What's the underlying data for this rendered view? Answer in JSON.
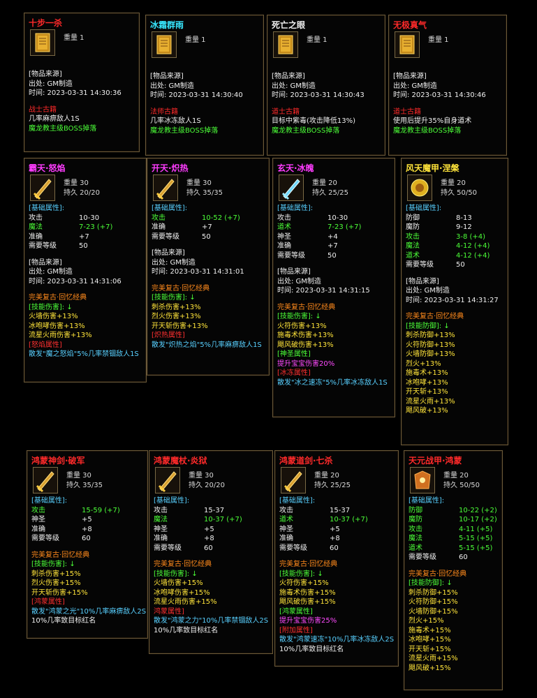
{
  "row1": [
    {
      "title": "十步一杀",
      "title_color": "#ff2a2a",
      "weight": "重量 1",
      "source": [
        "[物品来源]",
        "出处: GM制造",
        "时间: 2023-03-31 14:30:36"
      ],
      "lines": [
        [
          "战士古籍",
          "#ff2a2a"
        ],
        [
          "几率麻痹敌人1S",
          "#f0f0f0"
        ],
        [
          "魔龙教主级BOSS掉落",
          "#4cff38"
        ]
      ]
    },
    {
      "title": "冰霜群雨",
      "title_color": "#38e8ff",
      "weight": "重量 1",
      "source": [
        "[物品来源]",
        "出处: GM制造",
        "时间: 2023-03-31 14:30:40"
      ],
      "lines": [
        [
          "法师古籍",
          "#ff2a2a"
        ],
        [
          "几率冰冻敌人1S",
          "#f0f0f0"
        ],
        [
          "魔龙教主级BOSS掉落",
          "#4cff38"
        ]
      ]
    },
    {
      "title": "死亡之眼",
      "title_color": "#f0f0f0",
      "weight": "重量 1",
      "source": [
        "[物品来源]",
        "出处: GM制造",
        "时间: 2023-03-31 14:30:43"
      ],
      "lines": [
        [
          "道士古籍",
          "#ff2a2a"
        ],
        [
          "目标中紫毒(攻击降低13%)",
          "#f0f0f0"
        ],
        [
          "魔龙教主级BOSS掉落",
          "#4cff38"
        ]
      ]
    },
    {
      "title": "无极真气",
      "title_color": "#ff2a2a",
      "weight": "重量 1",
      "source": [
        "[物品来源]",
        "出处: GM制造",
        "时间: 2023-03-31 14:30:46"
      ],
      "lines": [
        [
          "道士古籍",
          "#ff2a2a"
        ],
        [
          "使用后提升35%自身道术",
          "#f0f0f0"
        ],
        [
          "魔龙教主级BOSS掉落",
          "#4cff38"
        ]
      ]
    }
  ],
  "row2": [
    {
      "title": "霸天·怒焰",
      "title_color": "#ff3cff",
      "weight": "重量 30",
      "dura": "持久 20/20",
      "basic_header": "[基础属性]:",
      "stats": [
        [
          "攻击",
          "10-30",
          "#f0f0f0"
        ],
        [
          "魔法",
          "7-23 (+7)",
          "#4cff38"
        ],
        [
          "准确",
          "+7",
          "#f0f0f0"
        ],
        [
          "需要等级",
          "50",
          "#f0f0f0"
        ]
      ],
      "source": [
        "[物品来源]",
        "出处: GM制造",
        "时间: 2023-03-31 14:31:06"
      ],
      "lines": [
        [
          "完美复古·回忆经典",
          "#ff8a1c"
        ],
        [
          "[技能伤害]: ↓",
          "#4cff38"
        ],
        [
          "火墙伤害+13%",
          "#ffe43a"
        ],
        [
          "冰咆哮伤害+13%",
          "#ffe43a"
        ],
        [
          "流星火雨伤害+13%",
          "#ffe43a"
        ],
        [
          "[怒焰属性]",
          "#ff3030"
        ],
        [
          "散发\"魔之怒焰\"5%几率禁锢敌人1S",
          "#58d0ff"
        ]
      ]
    },
    {
      "title": "开天·炽热",
      "title_color": "#ff3cff",
      "weight": "重量 30",
      "dura": "持久 35/35",
      "basic_header": "[基础属性]:",
      "stats": [
        [
          "攻击",
          "10-52 (+7)",
          "#4cff38"
        ],
        [
          "准确",
          "+7",
          "#f0f0f0"
        ],
        [
          "需要等级",
          "50",
          "#f0f0f0"
        ]
      ],
      "source": [
        "[物品来源]",
        "出处: GM制造",
        "时间: 2023-03-31 14:31:01"
      ],
      "lines": [
        [
          "完美复古·回忆经典",
          "#ff8a1c"
        ],
        [
          "[技能伤害]: ↓",
          "#4cff38"
        ],
        [
          "刺杀伤害+13%",
          "#ffe43a"
        ],
        [
          "烈火伤害+13%",
          "#ffe43a"
        ],
        [
          "开天斩伤害+13%",
          "#ffe43a"
        ],
        [
          "[炽热属性]",
          "#ff3030"
        ],
        [
          "散发\"炽热之焰\"5%几率麻痹敌人1S",
          "#58d0ff"
        ]
      ]
    },
    {
      "title": "玄天·冰魄",
      "title_color": "#ff3cff",
      "weight": "重量 20",
      "dura": "持久 25/25",
      "basic_header": "[基础属性]:",
      "stats": [
        [
          "攻击",
          "10-30",
          "#f0f0f0"
        ],
        [
          "道术",
          "7-23 (+7)",
          "#4cff38"
        ],
        [
          "神圣",
          "+4",
          "#f0f0f0"
        ],
        [
          "准确",
          "+7",
          "#f0f0f0"
        ],
        [
          "需要等级",
          "50",
          "#f0f0f0"
        ]
      ],
      "source": [
        "[物品来源]",
        "出处: GM制造",
        "时间: 2023-03-31 14:31:15"
      ],
      "lines": [
        [
          "完美复古·回忆经典",
          "#ff8a1c"
        ],
        [
          "[技能伤害]: ↓",
          "#4cff38"
        ],
        [
          "火符伤害+13%",
          "#ffe43a"
        ],
        [
          "施毒术伤害+13%",
          "#ffe43a"
        ],
        [
          "飓风破伤害+13%",
          "#ffe43a"
        ],
        [
          "[神圣属性]",
          "#4cff38"
        ],
        [
          "提升宝宝伤害20%",
          "#ff4aff"
        ],
        [
          "[冰冻属性]",
          "#ff3030"
        ],
        [
          "散发\"冰之速冻\"5%几率冰冻敌人1S",
          "#58d0ff"
        ]
      ]
    },
    {
      "title": "风天魔甲·涅槃",
      "title_color": "#ffe43a",
      "weight": "重量 20",
      "dura": "持久 50/50",
      "basic_header": "[基础属性]:",
      "stats": [
        [
          "防御",
          "8-13",
          "#f0f0f0"
        ],
        [
          "魔防",
          "9-12",
          "#f0f0f0"
        ],
        [
          "攻击",
          "3-8 (+4)",
          "#4cff38"
        ],
        [
          "魔法",
          "4-12 (+4)",
          "#4cff38"
        ],
        [
          "道术",
          "4-12 (+4)",
          "#4cff38"
        ],
        [
          "需要等级",
          "50",
          "#f0f0f0"
        ]
      ],
      "source": [
        "[物品来源]",
        "出处: GM制造",
        "时间: 2023-03-31 14:31:27"
      ],
      "lines": [
        [
          "完美复古·回忆经典",
          "#ff8a1c"
        ],
        [
          "[技能防御]: ↓",
          "#4cff38"
        ],
        [
          "刺杀防御+13%",
          "#ffe43a"
        ],
        [
          "火符防御+13%",
          "#ffe43a"
        ],
        [
          "火墙防御+13%",
          "#ffe43a"
        ],
        [
          "烈火+13%",
          "#ffe43a"
        ],
        [
          "施毒术+13%",
          "#ffe43a"
        ],
        [
          "冰咆哮+13%",
          "#ffe43a"
        ],
        [
          "开天斩+13%",
          "#ffe43a"
        ],
        [
          "流星火雨+13%",
          "#ffe43a"
        ],
        [
          "飓风破+13%",
          "#ffe43a"
        ]
      ]
    }
  ],
  "row3": [
    {
      "title": "鸿蒙神剑·破军",
      "title_color": "#ff2a2a",
      "weight": "重量 30",
      "dura": "持久 35/35",
      "basic_header": "[基础属性]:",
      "stats": [
        [
          "攻击",
          "15-59 (+7)",
          "#4cff38"
        ],
        [
          "神圣",
          "+5",
          "#f0f0f0"
        ],
        [
          "准确",
          "+8",
          "#f0f0f0"
        ],
        [
          "需要等级",
          "60",
          "#f0f0f0"
        ]
      ],
      "lines": [
        [
          "完美复古·回忆经典",
          "#ff8a1c"
        ],
        [
          "[技能伤害]: ↓",
          "#4cff38"
        ],
        [
          "刺杀伤害+15%",
          "#ffe43a"
        ],
        [
          "烈火伤害+15%",
          "#ffe43a"
        ],
        [
          "开天斩伤害+15%",
          "#ffe43a"
        ],
        [
          "[鸿蒙属性]",
          "#ff3030"
        ],
        [
          "散发\"鸿蒙之光\"10%几率麻痹敌人2S",
          "#58d0ff"
        ],
        [
          "10%几率致目标红名",
          "#f0f0f0"
        ]
      ]
    },
    {
      "title": "鸿蒙魔杖·炎狱",
      "title_color": "#ff2a2a",
      "weight": "重量 30",
      "dura": "持久 20/20",
      "basic_header": "[基础属性]:",
      "stats": [
        [
          "攻击",
          "15-37",
          "#f0f0f0"
        ],
        [
          "魔法",
          "10-37 (+7)",
          "#4cff38"
        ],
        [
          "神圣",
          "+5",
          "#f0f0f0"
        ],
        [
          "准确",
          "+8",
          "#f0f0f0"
        ],
        [
          "需要等级",
          "60",
          "#f0f0f0"
        ]
      ],
      "lines": [
        [
          "完美复古·回忆经典",
          "#ff8a1c"
        ],
        [
          "[技能伤害]: ↓",
          "#4cff38"
        ],
        [
          "火墙伤害+15%",
          "#ffe43a"
        ],
        [
          "冰咆哮伤害+15%",
          "#ffe43a"
        ],
        [
          "流星火雨伤害+15%",
          "#ffe43a"
        ],
        [
          "鸿蒙属性]",
          "#ff3030"
        ],
        [
          "散发\"鸿蒙之力\"10%几率禁锢敌人2S",
          "#58d0ff"
        ],
        [
          "10%几率致目标红名",
          "#f0f0f0"
        ]
      ]
    },
    {
      "title": "鸿蒙道剑·七杀",
      "title_color": "#ff2a2a",
      "weight": "重量 20",
      "dura": "持久 25/25",
      "basic_header": "[基础属性]:",
      "stats": [
        [
          "攻击",
          "15-37",
          "#f0f0f0"
        ],
        [
          "道术",
          "10-37 (+7)",
          "#4cff38"
        ],
        [
          "神圣",
          "+5",
          "#f0f0f0"
        ],
        [
          "准确",
          "+8",
          "#f0f0f0"
        ],
        [
          "需要等级",
          "60",
          "#f0f0f0"
        ]
      ],
      "lines": [
        [
          "完美复古·回忆经典",
          "#ff8a1c"
        ],
        [
          "[技能伤害]: ↓",
          "#4cff38"
        ],
        [
          "火符伤害+15%",
          "#ffe43a"
        ],
        [
          "施毒术伤害+15%",
          "#ffe43a"
        ],
        [
          "飓风破伤害+15%",
          "#ffe43a"
        ],
        [
          "[鸿蒙属性]",
          "#4cff38"
        ],
        [
          "提升宝宝伤害25%",
          "#ff4aff"
        ],
        [
          "[附加属性]",
          "#ff3030"
        ],
        [
          "散发\"鸿蒙速冻\"10%几率冰冻敌人2S",
          "#58d0ff"
        ],
        [
          "10%几率致目标红名",
          "#f0f0f0"
        ]
      ]
    },
    {
      "title": "天元战甲·鸿蒙",
      "title_color": "#ff2a2a",
      "weight": "重量 20",
      "dura": "持久 50/50",
      "basic_header": "[基础属性]:",
      "stats": [
        [
          "防御",
          "10-22 (+2)",
          "#4cff38"
        ],
        [
          "魔防",
          "10-17 (+2)",
          "#4cff38"
        ],
        [
          "攻击",
          "4-11 (+5)",
          "#4cff38"
        ],
        [
          "魔法",
          "5-15 (+5)",
          "#4cff38"
        ],
        [
          "道术",
          "5-15 (+5)",
          "#4cff38"
        ],
        [
          "需要等级",
          "60",
          "#f0f0f0"
        ]
      ],
      "lines": [
        [
          "完美复古·回忆经典",
          "#ff8a1c"
        ],
        [
          "[技能防御]: ↓",
          "#4cff38"
        ],
        [
          "刺杀防御+15%",
          "#ffe43a"
        ],
        [
          "火符防御+15%",
          "#ffe43a"
        ],
        [
          "火墙防御+15%",
          "#ffe43a"
        ],
        [
          "烈火+15%",
          "#ffe43a"
        ],
        [
          "施毒术+15%",
          "#ffe43a"
        ],
        [
          "冰咆哮+15%",
          "#ffe43a"
        ],
        [
          "开天斩+15%",
          "#ffe43a"
        ],
        [
          "流星火雨+15%",
          "#ffe43a"
        ],
        [
          "飓风破+15%",
          "#ffe43a"
        ]
      ]
    }
  ]
}
